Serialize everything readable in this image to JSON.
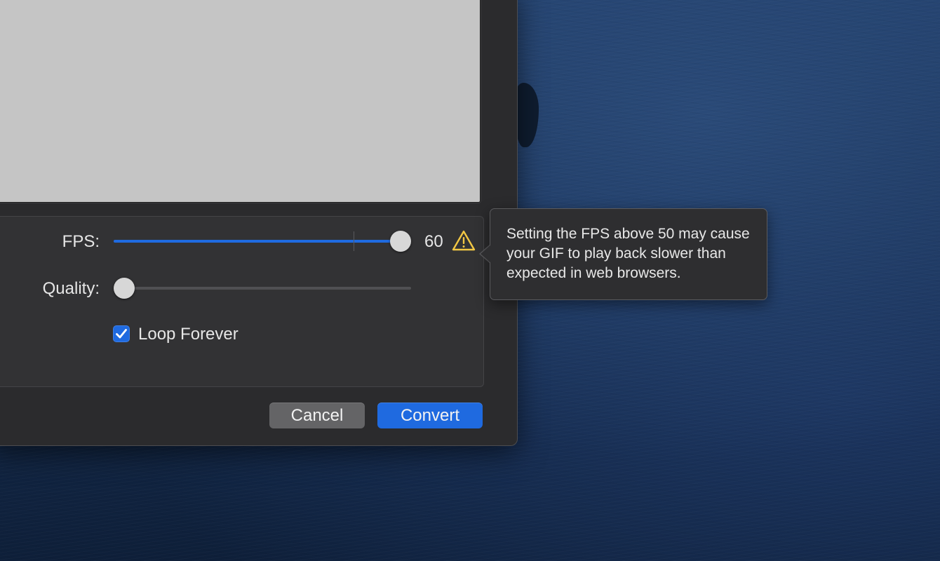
{
  "dialog": {
    "fps": {
      "label": "FPS:",
      "value": 60,
      "value_text": "60",
      "min": 1,
      "max": 60,
      "marker_value": 50,
      "warning_icon": "warning-triangle-icon"
    },
    "quality": {
      "label": "Quality:",
      "value": 0
    },
    "loop": {
      "label": "Loop Forever",
      "checked": true,
      "check_icon": "checkmark-icon"
    },
    "buttons": {
      "cancel_label": "Cancel",
      "convert_label": "Convert"
    }
  },
  "popover": {
    "text": "Setting the FPS above 50 may cause your GIF to play back slower than expected in web browsers."
  },
  "colors": {
    "accent": "#1f6ae0",
    "warning": "#f2c744",
    "panel": "#2b2b2d"
  }
}
